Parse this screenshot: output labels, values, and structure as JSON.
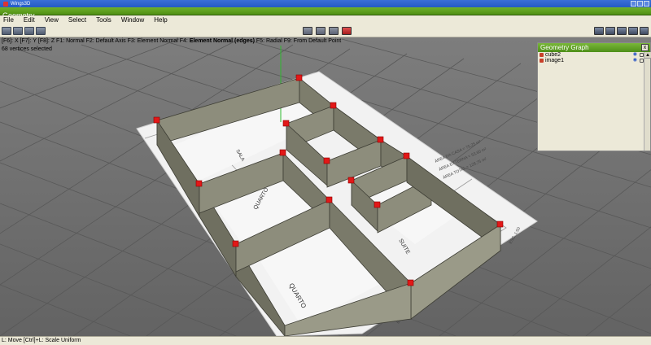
{
  "window": {
    "title": "Wings3D"
  },
  "geometry_bar": {
    "label": "Geometry"
  },
  "menu": [
    "File",
    "Edit",
    "View",
    "Select",
    "Tools",
    "Window",
    "Help"
  ],
  "info": {
    "line_prefix": "[F6]: X  [F7]: Y  [F8]: Z  F1: Normal  F2: Default Axis  F3: Element Normal  F4: ",
    "line_bold": "Element Normal (edges)",
    "line_suffix": "  F5: Radial  F9: From Default Point",
    "selection": "68 vertices selected"
  },
  "plan_labels": {
    "quarto_top": "QUARTO",
    "quarto_bottom": "QUARTO",
    "suite": "SUITE",
    "sala": "SALA",
    "area_1": "ÁREA DA CASA = 75,25 m²",
    "area_2": "ÁREA EXTERNA = 53,60 m²",
    "area_3": "ÁREA TOTAL = 128,75 m²",
    "scale": "ESC. 1:50",
    "dim": "6,55"
  },
  "graph_panel": {
    "title": "Geometry Graph",
    "close": "x",
    "items": [
      {
        "name": "cube2",
        "icon_color": "#c8402a"
      },
      {
        "name": "image1",
        "icon_color": "#c8402a"
      }
    ]
  },
  "status": {
    "text": "L: Move  [Ctrl]+L: Scale Uniform"
  }
}
